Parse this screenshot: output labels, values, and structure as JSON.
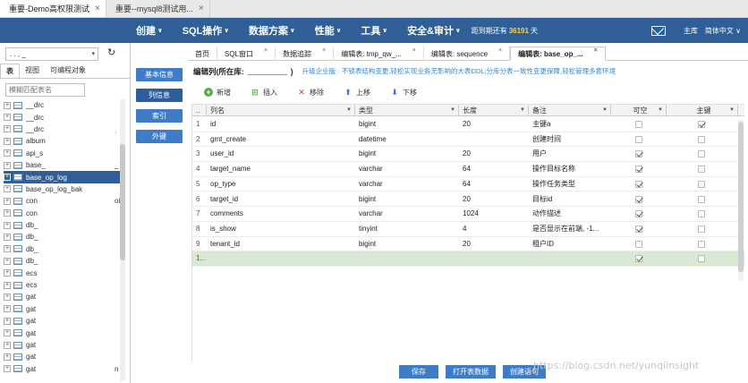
{
  "browser_tabs": [
    {
      "label": "重要-Demo高权限测试",
      "active": true
    },
    {
      "label": "重要--mysql8测试用...",
      "active": false
    }
  ],
  "menu": {
    "items": [
      "创建",
      "SQL操作",
      "数据方案",
      "性能",
      "工具",
      "安全&审计"
    ],
    "expiry_prefix": "距到期还有",
    "expiry_days": "36191",
    "expiry_suffix": "天",
    "right_items": [
      "主库",
      "简体中文"
    ]
  },
  "left": {
    "db_select": ". . , _",
    "tabs": [
      "表",
      "视图",
      "可编程对象"
    ],
    "filter_placeholder": "模糊匹配表名",
    "tree": [
      {
        "label": "__drc",
        "suffix": ""
      },
      {
        "label": "__drc",
        "suffix": ""
      },
      {
        "label": "__drc",
        "suffix": "ˌ"
      },
      {
        "label": "album",
        "suffix": ""
      },
      {
        "label": "api_s",
        "suffix": ""
      },
      {
        "label": "base_",
        "suffix": "_"
      },
      {
        "label": "base_op_log",
        "suffix": "",
        "selected": true
      },
      {
        "label": "base_op_log_bak",
        "suffix": ""
      },
      {
        "label": "con",
        "suffix": "oi"
      },
      {
        "label": "con",
        "suffix": ""
      },
      {
        "label": "db_",
        "suffix": ""
      },
      {
        "label": "db_",
        "suffix": ""
      },
      {
        "label": "db_",
        "suffix": ""
      },
      {
        "label": "db_",
        "suffix": ""
      },
      {
        "label": "ecs",
        "suffix": ""
      },
      {
        "label": "ecs",
        "suffix": ""
      },
      {
        "label": "gat",
        "suffix": ""
      },
      {
        "label": "gat",
        "suffix": ""
      },
      {
        "label": "gat",
        "suffix": ""
      },
      {
        "label": "gat",
        "suffix": ""
      },
      {
        "label": "gat",
        "suffix": ""
      },
      {
        "label": "gat",
        "suffix": ""
      },
      {
        "label": "gat",
        "suffix": "n"
      }
    ]
  },
  "side_buttons": [
    "基本信息",
    "列信息",
    "索引",
    "外键"
  ],
  "editor_tabs": [
    {
      "label": "首页",
      "closable": false,
      "active": false
    },
    {
      "label": "SQL窗口",
      "closable": true,
      "active": false
    },
    {
      "label": "数据追踪",
      "closable": true,
      "active": false
    },
    {
      "label": "编辑表: tmp_qw_...",
      "closable": true,
      "active": false
    },
    {
      "label": "编辑表: sequence",
      "closable": true,
      "active": false
    },
    {
      "label": "编辑表: base_op_...",
      "closable": true,
      "active": true
    }
  ],
  "edit_line": {
    "label": "编辑列(所在库:",
    "close_paren": ")",
    "notice": "升级企业版 · 不锁表结构变更,轻松实现业务无影响的大表DDL;分库分表一致性变更保障,轻松管理多套环境"
  },
  "toolbar": [
    "新增",
    "插入",
    "移除",
    "上移",
    "下移"
  ],
  "grid": {
    "headers": [
      "列名",
      "类型",
      "长度",
      "备注",
      "可空",
      "主键"
    ],
    "rows": [
      {
        "num": "1",
        "name": "id",
        "type": "bigint",
        "length": "20",
        "comment": "主键a",
        "nullable": false,
        "pk": true
      },
      {
        "num": "2",
        "name": "gmt_create",
        "type": "datetime",
        "length": "",
        "comment": "创建时间",
        "nullable": false,
        "pk": false
      },
      {
        "num": "3",
        "name": "user_id",
        "type": "bigint",
        "length": "20",
        "comment": "用户",
        "nullable": true,
        "pk": false
      },
      {
        "num": "4",
        "name": "target_name",
        "type": "varchar",
        "length": "64",
        "comment": "操作目标名称",
        "nullable": true,
        "pk": false
      },
      {
        "num": "5",
        "name": "op_type",
        "type": "varchar",
        "length": "64",
        "comment": "操作任务类型",
        "nullable": true,
        "pk": false
      },
      {
        "num": "6",
        "name": "target_id",
        "type": "bigint",
        "length": "20",
        "comment": "目标id",
        "nullable": true,
        "pk": false
      },
      {
        "num": "7",
        "name": "comments",
        "type": "varchar",
        "length": "1024",
        "comment": "动作描述",
        "nullable": true,
        "pk": false
      },
      {
        "num": "8",
        "name": "is_show",
        "type": "tinyint",
        "length": "4",
        "comment": "是否显示在前端, -1...",
        "nullable": true,
        "pk": false
      },
      {
        "num": "9",
        "name": "tenant_id",
        "type": "bigint",
        "length": "20",
        "comment": "租户ID",
        "nullable": false,
        "pk": false
      },
      {
        "num": "1...",
        "name": "",
        "type": "",
        "length": "",
        "comment": "",
        "nullable": true,
        "pk": false,
        "new": true
      }
    ]
  },
  "bottom_buttons": [
    "保存",
    "打开表数据",
    "创建语句"
  ],
  "watermark": "https://blog.csdn.net/yunqiinsight"
}
